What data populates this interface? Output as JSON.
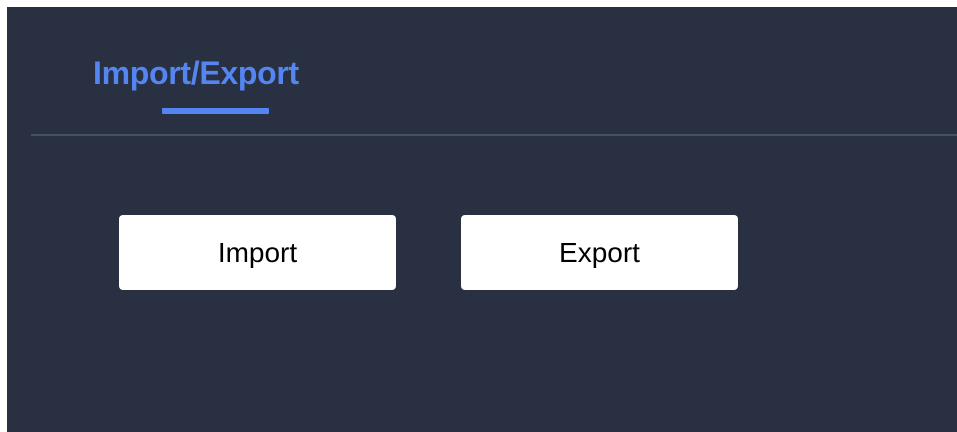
{
  "tabs": [
    {
      "label": "Import/Export",
      "active": true
    }
  ],
  "actions": {
    "import_label": "Import",
    "export_label": "Export"
  },
  "colors": {
    "background": "#283041",
    "accent": "#5585f1",
    "divider": "#465063",
    "button_bg": "#ffffff",
    "button_text": "#000000"
  }
}
